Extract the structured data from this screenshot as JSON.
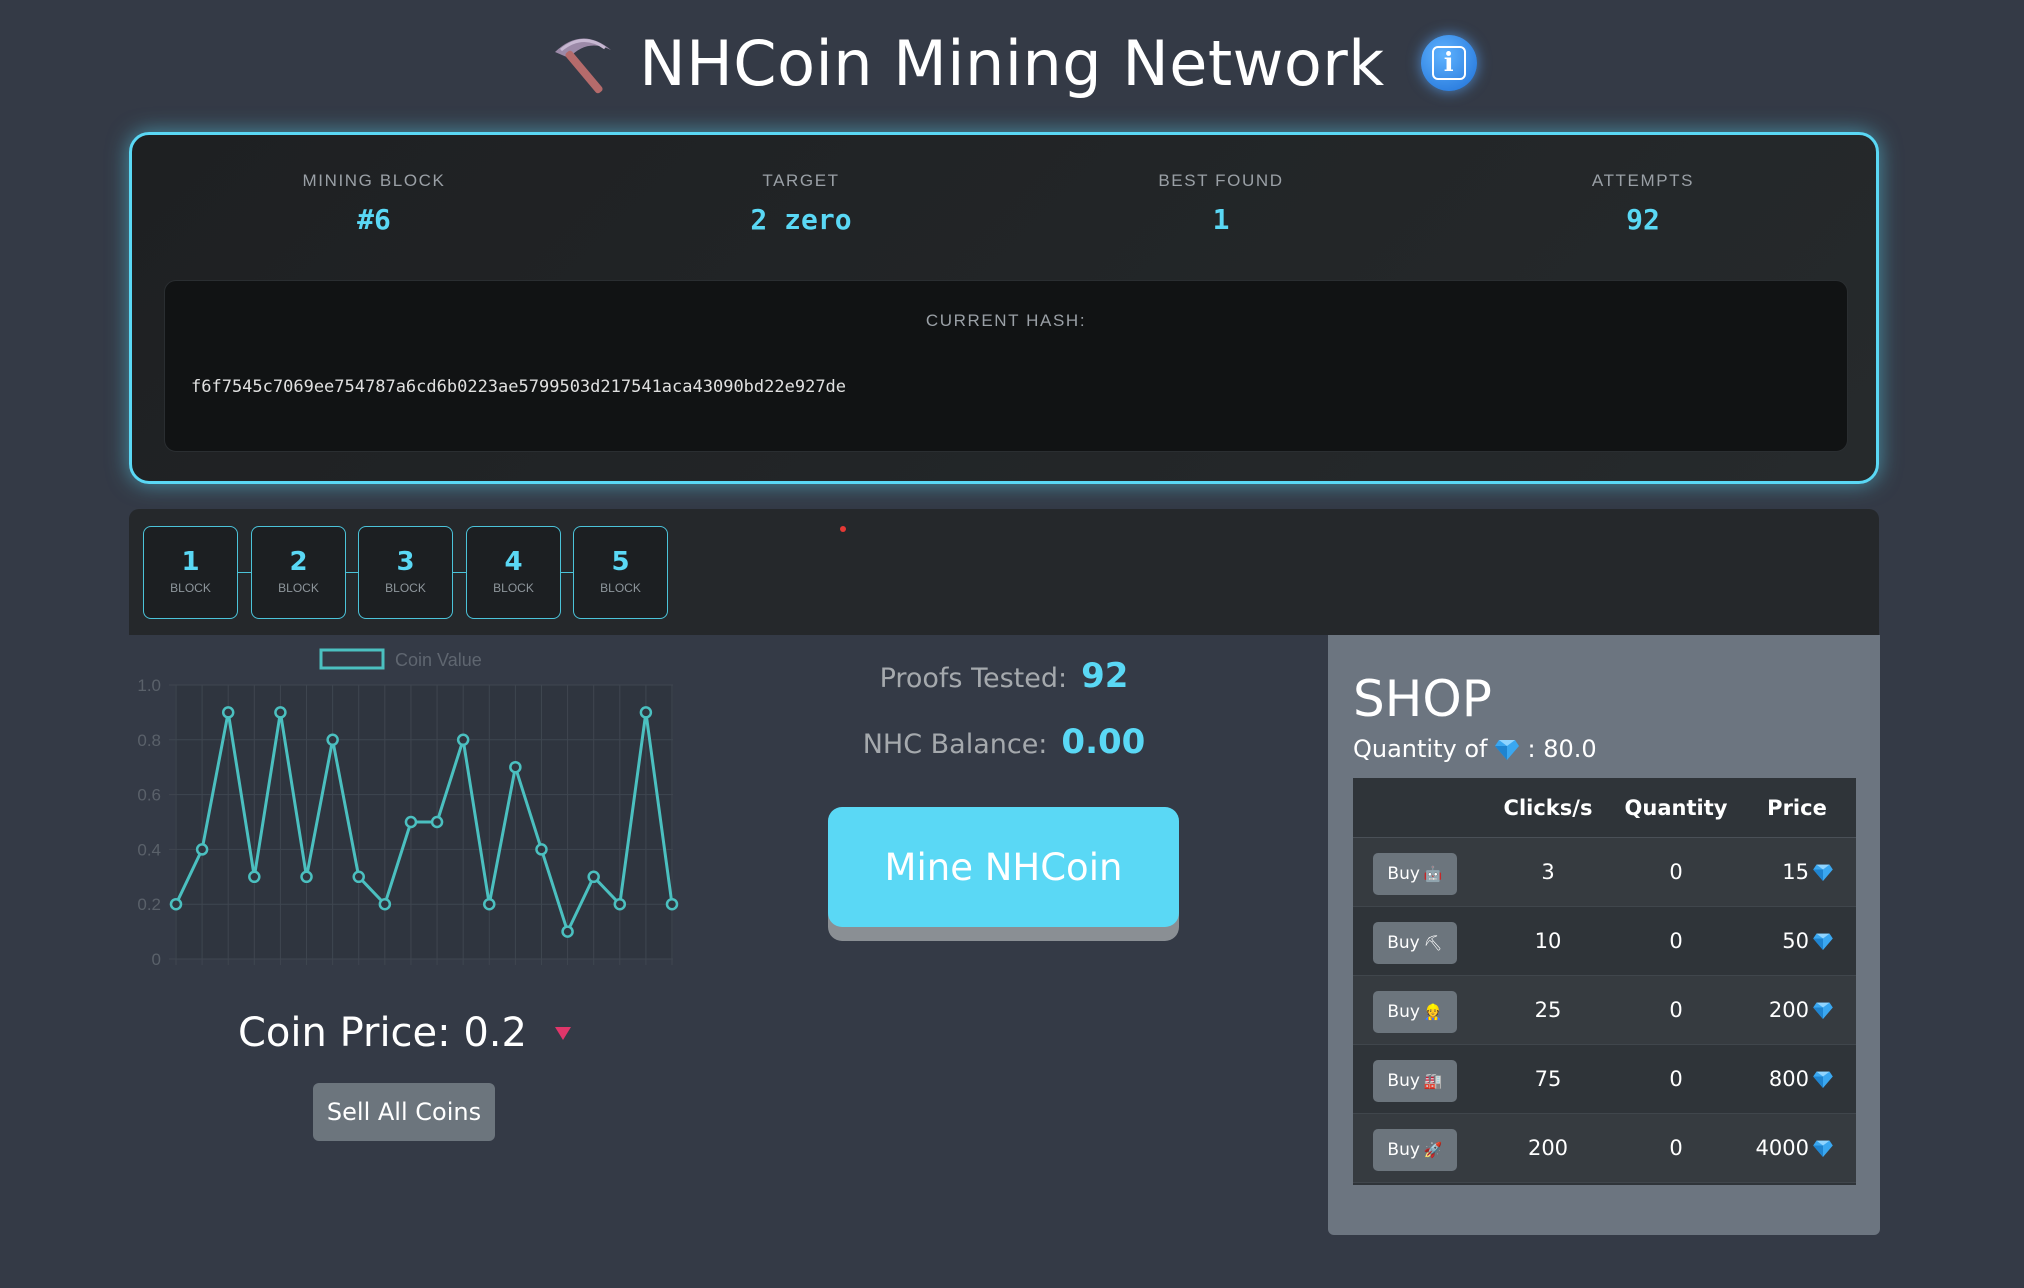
{
  "header": {
    "title": "NHCoin Mining Network",
    "icon": "pickaxe-icon",
    "info_icon": "info-icon"
  },
  "mining": {
    "stats": [
      {
        "label": "MINING BLOCK",
        "value": "#6"
      },
      {
        "label": "TARGET",
        "value": "2 zero"
      },
      {
        "label": "BEST FOUND",
        "value": "1"
      },
      {
        "label": "ATTEMPTS",
        "value": "92"
      }
    ],
    "hash_label": "CURRENT HASH:",
    "hash_value": "f6f7545c7069ee754787a6cd6b0223ae5799503d217541aca43090bd22e927de"
  },
  "chain": {
    "blocks": [
      {
        "number": "1",
        "label": "BLOCK"
      },
      {
        "number": "2",
        "label": "BLOCK"
      },
      {
        "number": "3",
        "label": "BLOCK"
      },
      {
        "number": "4",
        "label": "BLOCK"
      },
      {
        "number": "5",
        "label": "BLOCK"
      }
    ]
  },
  "chart_data": {
    "type": "line",
    "legend": [
      "Coin Value"
    ],
    "legend_position": "top",
    "grid": true,
    "ylim": [
      0,
      1.0
    ],
    "yticks": [
      "0",
      "0.2",
      "0.4",
      "0.6",
      "0.8",
      "1.0"
    ],
    "series": [
      {
        "name": "Coin Value",
        "color": "#4bc0c0",
        "values": [
          0.2,
          0.4,
          0.9,
          0.3,
          0.9,
          0.3,
          0.8,
          0.3,
          0.2,
          0.5,
          0.5,
          0.8,
          0.2,
          0.7,
          0.4,
          0.1,
          0.3,
          0.2,
          0.9,
          0.2
        ]
      }
    ]
  },
  "price": {
    "label": "Coin Price: 0.2",
    "trend": "down",
    "trend_color": "#e0366a",
    "sell_label": "Sell All Coins"
  },
  "center": {
    "proofs_label": "Proofs Tested:",
    "proofs_value": "92",
    "balance_label": "NHC Balance:",
    "balance_value": "0.00",
    "mine_label": "Mine NHCoin"
  },
  "shop": {
    "title": "SHOP",
    "quantity_prefix": "Quantity of",
    "quantity_value": ": 80.0",
    "currency_icon": "gem-icon",
    "columns": [
      "",
      "Clicks/s",
      "Quantity",
      "Price"
    ],
    "items": [
      {
        "buy_label": "Buy",
        "icon": "robot-icon",
        "clicks": "3",
        "quantity": "0",
        "price": "15"
      },
      {
        "buy_label": "Buy",
        "icon": "pickaxe-icon",
        "clicks": "10",
        "quantity": "0",
        "price": "50"
      },
      {
        "buy_label": "Buy",
        "icon": "worker-icon",
        "clicks": "25",
        "quantity": "0",
        "price": "200"
      },
      {
        "buy_label": "Buy",
        "icon": "factory-icon",
        "clicks": "75",
        "quantity": "0",
        "price": "800"
      },
      {
        "buy_label": "Buy",
        "icon": "rocket-icon",
        "clicks": "200",
        "quantity": "0",
        "price": "4000"
      }
    ]
  },
  "colors": {
    "accent": "#5ad8f5",
    "background": "#343a46",
    "shop_bg": "#6c7580"
  }
}
